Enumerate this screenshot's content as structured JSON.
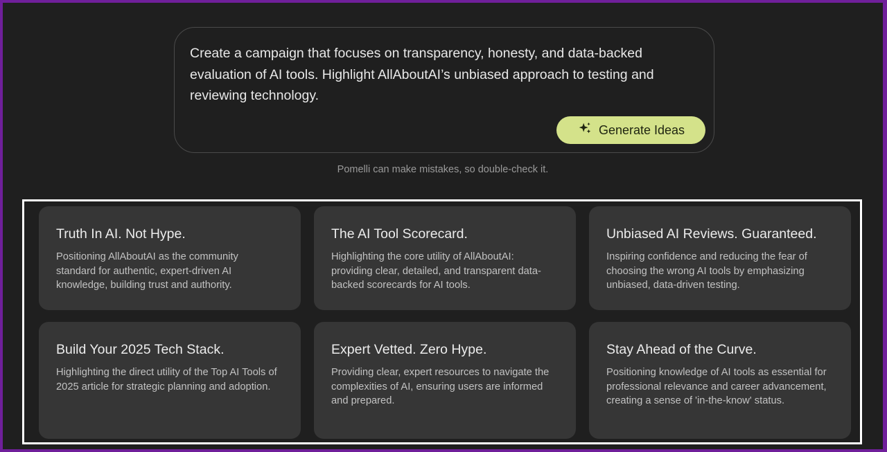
{
  "prompt": {
    "text": "Create a campaign that focuses on transparency, honesty, and data-backed evaluation of AI tools. Highlight AllAboutAI’s unbiased approach to testing and reviewing technology.",
    "generate_label": "Generate Ideas",
    "generate_icon": "sparkle-icon"
  },
  "disclaimer": "Pomelli can make mistakes, so double-check it.",
  "cards": [
    {
      "title": "Truth In AI. Not Hype.",
      "description": "Positioning AllAboutAI as the community standard for authentic, expert-driven AI knowledge, building trust and authority."
    },
    {
      "title": "The AI Tool Scorecard.",
      "description": "Highlighting the core utility of AllAboutAI: providing clear, detailed, and transparent data-backed scorecards for AI tools."
    },
    {
      "title": "Unbiased AI Reviews. Guaranteed.",
      "description": "Inspiring confidence and reducing the fear of choosing the wrong AI tools by emphasizing unbiased, data-driven testing."
    },
    {
      "title": "Build Your 2025 Tech Stack.",
      "description": "Highlighting the direct utility of the Top AI Tools of 2025 article for strategic planning and adoption."
    },
    {
      "title": "Expert Vetted. Zero Hype.",
      "description": "Providing clear, expert resources to navigate the complexities of AI, ensuring users are informed and prepared."
    },
    {
      "title": "Stay Ahead of the Curve.",
      "description": "Positioning knowledge of AI tools as essential for professional relevance and career advancement, creating a sense of 'in-the-know' status."
    }
  ],
  "colors": {
    "page_border": "#6f1f9a",
    "background": "#1f1f1f",
    "card_background": "#363636",
    "accent_button": "#d4e28a",
    "highlight_border": "#ffffff"
  }
}
